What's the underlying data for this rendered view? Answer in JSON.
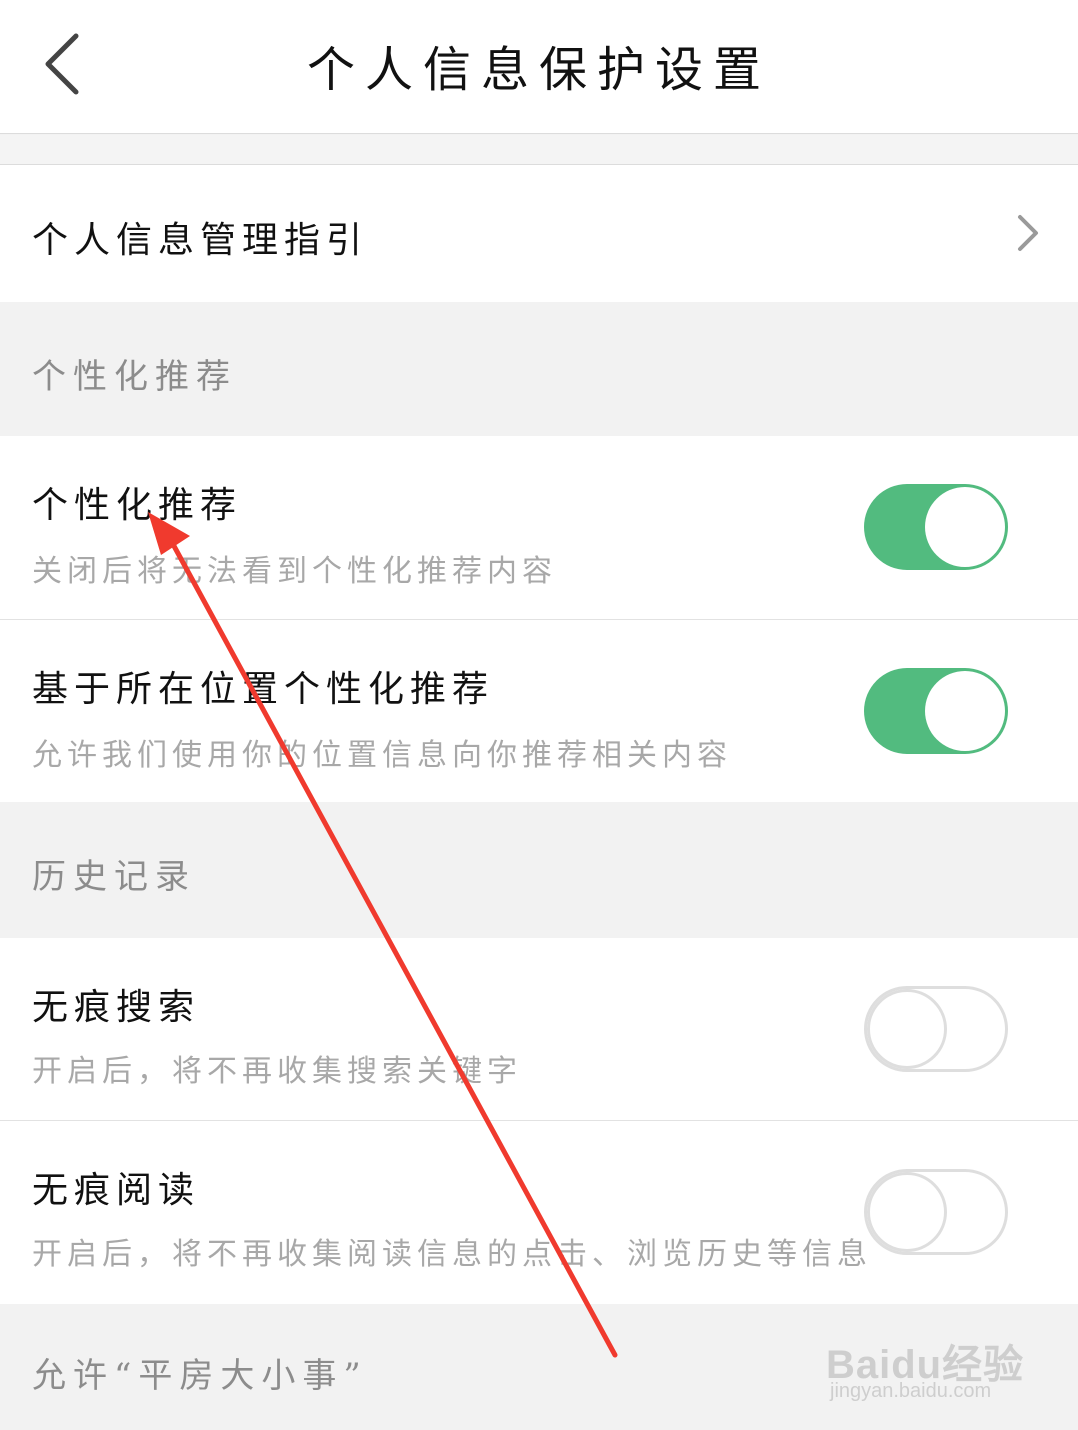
{
  "header": {
    "title": "个人信息保护设置"
  },
  "guide": {
    "label": "个人信息管理指引"
  },
  "sections": {
    "personalization": {
      "label": "个性化推荐"
    },
    "history": {
      "label": "历史记录"
    },
    "allow": {
      "label": "允许“平房大小事”"
    }
  },
  "settings": {
    "personalized": {
      "title": "个性化推荐",
      "subtitle": "关闭后将无法看到个性化推荐内容",
      "enabled": true
    },
    "location": {
      "title": "基于所在位置个性化推荐",
      "subtitle": "允许我们使用你的位置信息向你推荐相关内容",
      "enabled": true
    },
    "incognito_search": {
      "title": "无痕搜索",
      "subtitle": "开启后，将不再收集搜索关键字",
      "enabled": false
    },
    "incognito_read": {
      "title": "无痕阅读",
      "subtitle": "开启后，将不再收集阅读信息的点击、浏览历史等信息",
      "enabled": false
    }
  },
  "colors": {
    "toggle_on": "#52bb7f",
    "toggle_off_border": "#dedede",
    "annotation_arrow": "#f03a2e"
  },
  "watermark": {
    "logo": "Baidu经验",
    "url": "jingyan.baidu.com"
  }
}
